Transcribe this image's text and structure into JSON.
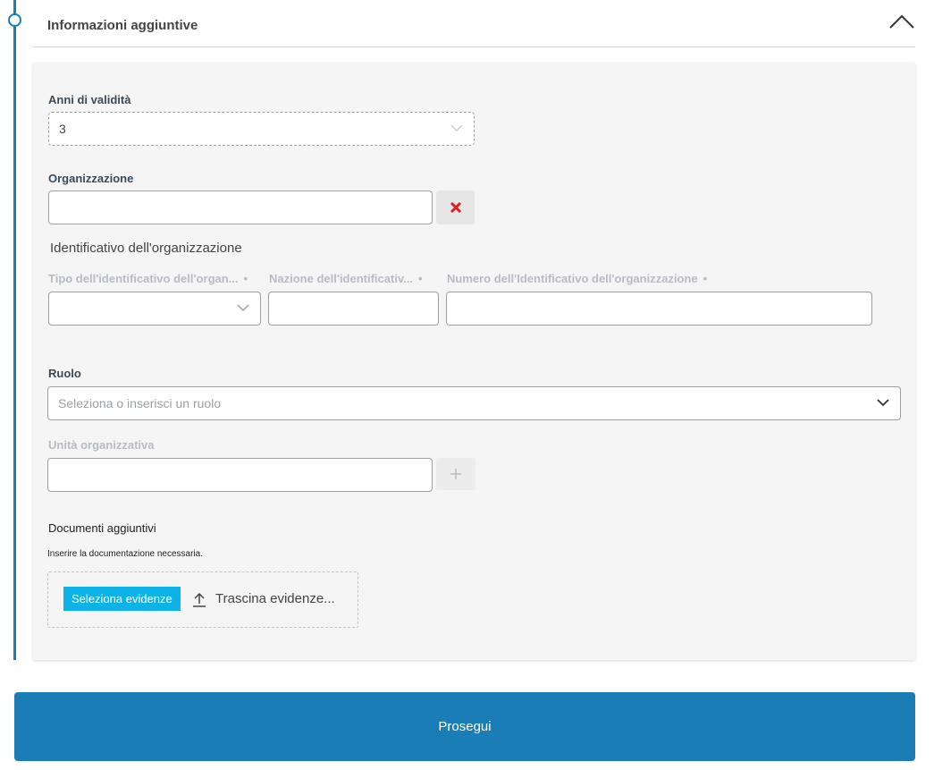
{
  "section": {
    "title": "Informazioni aggiuntive"
  },
  "validity": {
    "label": "Anni di validità",
    "value": "3"
  },
  "organization": {
    "label": "Organizzazione",
    "value": ""
  },
  "org_identifier": {
    "heading": "Identificativo dell'organizzazione",
    "type_label": "Tipo dell'identificativo dell'organ...",
    "nation_label": "Nazione dell'identificativ...",
    "number_label": "Numero dell'Identificativo dell'organizzazione",
    "required_mark": "•",
    "type_value": "",
    "nation_value": "",
    "number_value": ""
  },
  "role": {
    "label": "Ruolo",
    "placeholder": "Seleziona o inserisci un ruolo"
  },
  "unit": {
    "label": "Unità organizzativa",
    "value": ""
  },
  "documents": {
    "title": "Documenti aggiuntivi",
    "hint": "Inserire la documentazione necessaria.",
    "select_label": "Seleziona evidenze",
    "drag_label": "Trascina evidenze..."
  },
  "actions": {
    "continue_label": "Prosegui"
  },
  "colors": {
    "accent": "#1a7db5",
    "select_button": "#0db3e6",
    "clear_icon": "#e02020"
  },
  "icons": {
    "collapse": "chevron-up-icon",
    "dropdown": "chevron-down-icon",
    "clear": "close-icon",
    "add": "plus-icon",
    "upload": "upload-icon",
    "timeline": "timeline-node-icon"
  }
}
